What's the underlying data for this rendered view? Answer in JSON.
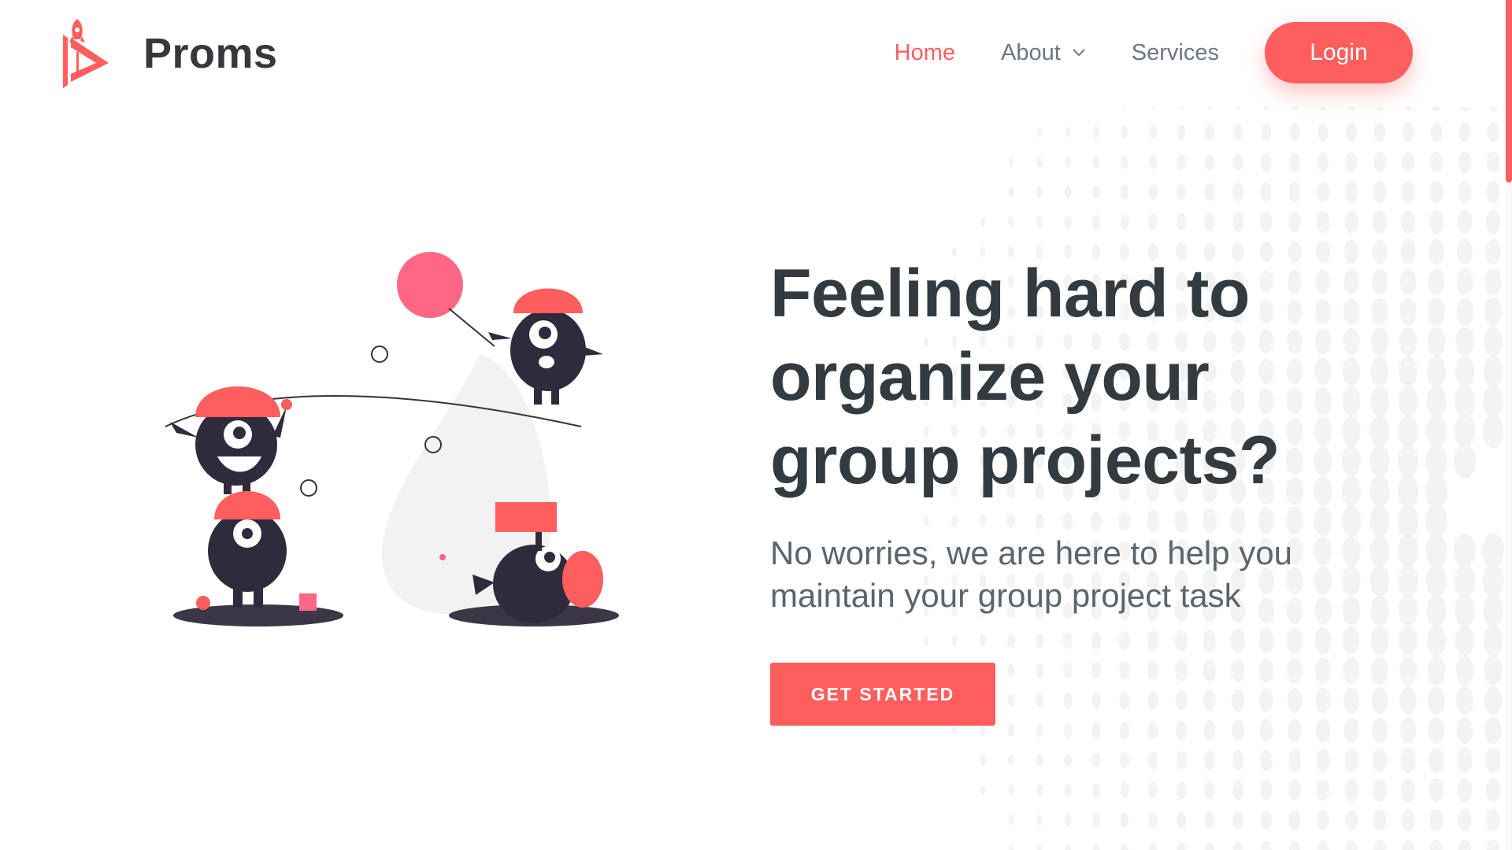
{
  "brand": {
    "name": "Proms",
    "accent_color": "#ff5e5e",
    "logo_icon": "rocket-play-logo-icon"
  },
  "nav": {
    "home_label": "Home",
    "about_label": "About",
    "services_label": "Services",
    "login_label": "Login"
  },
  "hero": {
    "title": "Feeling hard to organize your group projects?",
    "subtitle": "No worries, we are here to help you maintain your group project task",
    "cta_label": "GET STARTED"
  },
  "illustration": {
    "icon": "monsters-playing-illustration"
  }
}
